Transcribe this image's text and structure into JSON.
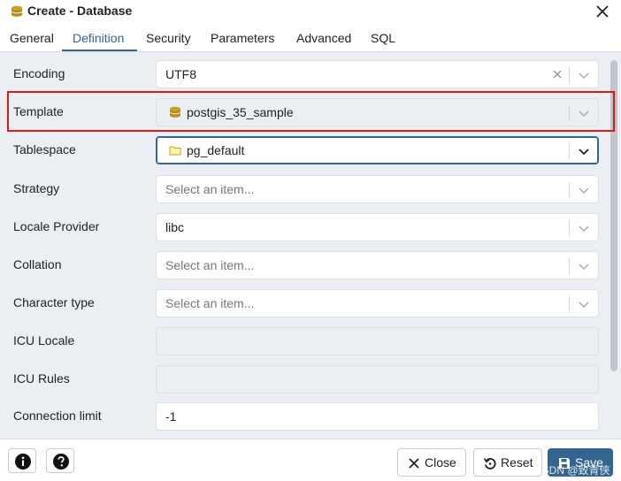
{
  "window": {
    "title": "Create - Database"
  },
  "tabs": [
    {
      "label": "General"
    },
    {
      "label": "Definition"
    },
    {
      "label": "Security"
    },
    {
      "label": "Parameters"
    },
    {
      "label": "Advanced"
    },
    {
      "label": "SQL"
    }
  ],
  "active_tab": "Definition",
  "form": {
    "encoding": {
      "label": "Encoding",
      "value": "UTF8"
    },
    "template": {
      "label": "Template",
      "value": "postgis_35_sample",
      "icon": "database-icon"
    },
    "tablespace": {
      "label": "Tablespace",
      "value": "pg_default",
      "icon": "folder-icon"
    },
    "strategy": {
      "label": "Strategy",
      "placeholder": "Select an item..."
    },
    "locale_provider": {
      "label": "Locale Provider",
      "value": "libc"
    },
    "collation": {
      "label": "Collation",
      "placeholder": "Select an item..."
    },
    "character_type": {
      "label": "Character type",
      "placeholder": "Select an item..."
    },
    "icu_locale": {
      "label": "ICU Locale",
      "value": ""
    },
    "icu_rules": {
      "label": "ICU Rules",
      "value": ""
    },
    "connection_limit": {
      "label": "Connection limit",
      "value": "-1"
    }
  },
  "footer": {
    "info_icon": "info-icon",
    "help_icon": "help-icon",
    "close_label": "Close",
    "reset_label": "Reset",
    "save_label": "Save"
  },
  "watermark": "CSDN @致青侠",
  "colors": {
    "accent": "#326690",
    "highlight": "#e01818",
    "content_bg": "#ebeef3"
  }
}
